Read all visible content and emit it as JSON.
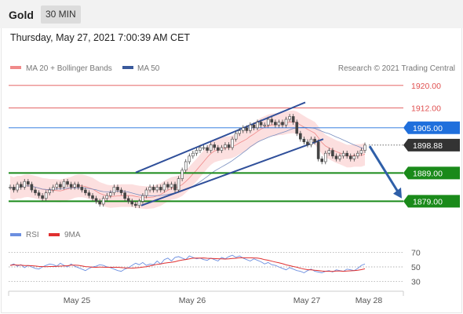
{
  "header": {
    "instrument": "Gold",
    "timeframe": "30 MIN"
  },
  "timestamp": "Thursday, May 27, 2021 7:00:39 AM CET",
  "legend": {
    "ma20": {
      "label": "MA 20 + Bollinger Bands",
      "color": "#f08a8a"
    },
    "ma50": {
      "label": "MA 50",
      "color": "#3a5a9c"
    },
    "rsi": {
      "label": "RSI",
      "color": "#6c8fe0"
    },
    "ma9": {
      "label": "9MA",
      "color": "#e03030"
    }
  },
  "watermark": "Research © 2021 Trading Central",
  "chart_data": [
    {
      "type": "candlestick",
      "x_labels": [
        "May 25",
        "May 26",
        "May 27",
        "May 28"
      ],
      "ylim": [
        1873,
        1923
      ],
      "levels": [
        {
          "label": "1920.00",
          "value": 1920.0,
          "role": "resistance",
          "color": "#e05050"
        },
        {
          "label": "1912.00",
          "value": 1912.0,
          "role": "resistance",
          "color": "#e05050"
        },
        {
          "label": "1905.00",
          "value": 1905.0,
          "role": "pivot",
          "color": "#1f6fdc"
        },
        {
          "label": "1898.88",
          "value": 1898.88,
          "role": "last price",
          "color": "#333333"
        },
        {
          "label": "1889.00",
          "value": 1889.0,
          "role": "support",
          "color": "#1a8a1a"
        },
        {
          "label": "1879.00",
          "value": 1879.0,
          "role": "support",
          "color": "#1a8a1a"
        }
      ],
      "channel": {
        "lower_start": 1877.5,
        "lower_end": 1901.0,
        "upper_start": 1889.2,
        "upper_end": 1914.0
      },
      "forecast_arrow": {
        "from": 1898.5,
        "to": 1880.0,
        "direction": "down"
      },
      "close": [
        1884,
        1883,
        1885,
        1884,
        1886,
        1885,
        1883,
        1882,
        1881,
        1880,
        1882,
        1883,
        1884,
        1885,
        1884,
        1886,
        1885,
        1884,
        1885,
        1884,
        1883,
        1882,
        1881,
        1880,
        1879,
        1878,
        1880,
        1881,
        1882,
        1884,
        1883,
        1882,
        1880,
        1879,
        1878,
        1877.5,
        1879,
        1881,
        1883,
        1884,
        1883,
        1884,
        1883,
        1885,
        1884,
        1885,
        1883,
        1887,
        1890,
        1893,
        1895,
        1896,
        1897,
        1898,
        1898,
        1897,
        1899,
        1898,
        1897,
        1898,
        1899,
        1898,
        1901,
        1903,
        1904,
        1905,
        1904,
        1906,
        1905,
        1907,
        1906,
        1906,
        1908,
        1907,
        1906,
        1907,
        1906,
        1908,
        1909,
        1907,
        1903,
        1901,
        1900,
        1899,
        1901,
        1900,
        1894,
        1893,
        1896,
        1897,
        1895,
        1894,
        1895,
        1896,
        1895,
        1894,
        1895,
        1896,
        1897,
        1898.88
      ],
      "rsi": [
        52,
        54,
        51,
        53,
        49,
        52,
        50,
        48,
        47,
        50,
        52,
        54,
        53,
        51,
        55,
        52,
        50,
        54,
        51,
        49,
        47,
        45,
        48,
        50,
        51,
        53,
        52,
        50,
        49,
        47,
        45,
        44,
        47,
        49,
        52,
        55,
        53,
        56,
        52,
        54,
        53,
        58,
        54,
        60,
        62,
        58,
        63,
        64,
        62,
        60,
        65,
        63,
        61,
        62,
        60,
        59,
        62,
        60,
        58,
        63,
        61,
        64,
        66,
        63,
        65,
        62,
        60,
        58,
        61,
        59,
        57,
        54,
        56,
        53,
        52,
        50,
        48,
        46,
        49,
        47,
        45,
        44,
        42,
        45,
        47,
        44,
        43,
        42,
        44,
        45,
        43,
        46,
        45,
        44,
        47,
        46,
        45,
        48,
        52,
        54
      ],
      "rsi_ylim": [
        20,
        80
      ],
      "rsi_levels": [
        70,
        50,
        30
      ]
    }
  ]
}
